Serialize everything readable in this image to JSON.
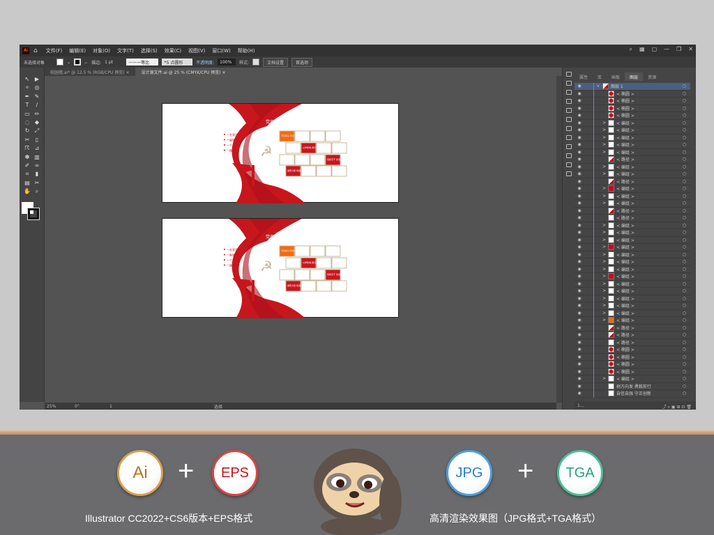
{
  "app": {
    "logo": "Ai",
    "home_icon": "home-icon"
  },
  "menu": [
    "文件(F)",
    "编辑(E)",
    "对象(O)",
    "文字(T)",
    "选择(S)",
    "效果(C)",
    "视图(V)",
    "窗口(W)",
    "帮助(H)"
  ],
  "control": {
    "selection": "未选择对象",
    "stroke_label": "描边:",
    "stroke_value": "1 pt",
    "profile": "等比",
    "brush": "5 点圆形",
    "opacity_label": "不透明度:",
    "opacity": "100%",
    "style_label": "样式:",
    "doc_setup": "文档设置",
    "prefs": "首选项"
  },
  "tabs": [
    {
      "label": "校园墙.ai* @ 12.5 % (RGB/CPU 预览)"
    },
    {
      "label": "设计源文件.ai @ 25 % (CMYK/CPU 预览)"
    }
  ],
  "status": {
    "zoom": "25%",
    "rotation": "0°",
    "page": "1",
    "tool": "选择"
  },
  "panel": {
    "tabs": [
      "属性",
      "库",
      "画板",
      "图层",
      "资源"
    ],
    "footer": "1..."
  },
  "layers": [
    {
      "name": "图层 1",
      "thumb": "top",
      "exp": "v"
    },
    {
      "name": "< 椭圆 >",
      "thumb": "dot"
    },
    {
      "name": "< 椭圆 >",
      "thumb": "dot"
    },
    {
      "name": "< 椭圆 >",
      "thumb": "dot"
    },
    {
      "name": "< 椭圆 >",
      "thumb": "dot"
    },
    {
      "name": "< 编组 >",
      "thumb": "white",
      "exp": ">"
    },
    {
      "name": "< 编组 >",
      "thumb": "white",
      "exp": ">"
    },
    {
      "name": "< 编组 >",
      "thumb": "white",
      "exp": ">"
    },
    {
      "name": "< 编组 >",
      "thumb": "white",
      "exp": ">"
    },
    {
      "name": "< 编组 >",
      "thumb": "white",
      "exp": ">"
    },
    {
      "name": "< 路径 >",
      "thumb": "path"
    },
    {
      "name": "< 编组 >",
      "thumb": "white",
      "exp": ">"
    },
    {
      "name": "< 编组 >",
      "thumb": "white",
      "exp": ">"
    },
    {
      "name": "< 路径 >",
      "thumb": "path"
    },
    {
      "name": "< 编组 >",
      "thumb": "red",
      "exp": ">"
    },
    {
      "name": "< 编组 >",
      "thumb": "white",
      "exp": ">"
    },
    {
      "name": "< 编组 >",
      "thumb": "white",
      "exp": ">"
    },
    {
      "name": "< 路径 >",
      "thumb": "path"
    },
    {
      "name": "< 路径 >",
      "thumb": "white"
    },
    {
      "name": "< 编组 >",
      "thumb": "white",
      "exp": ">"
    },
    {
      "name": "< 编组 >",
      "thumb": "white",
      "exp": ">"
    },
    {
      "name": "< 编组 >",
      "thumb": "white",
      "exp": ">"
    },
    {
      "name": "< 编组 >",
      "thumb": "red",
      "exp": ">"
    },
    {
      "name": "< 编组 >",
      "thumb": "white",
      "exp": ">"
    },
    {
      "name": "< 编组 >",
      "thumb": "white",
      "exp": ">"
    },
    {
      "name": "< 编组 >",
      "thumb": "white",
      "exp": ">"
    },
    {
      "name": "< 编组 >",
      "thumb": "red",
      "exp": ">"
    },
    {
      "name": "< 编组 >",
      "thumb": "white",
      "exp": ">"
    },
    {
      "name": "< 编组 >",
      "thumb": "white",
      "exp": ">"
    },
    {
      "name": "< 编组 >",
      "thumb": "white",
      "exp": ">"
    },
    {
      "name": "< 编组 >",
      "thumb": "white",
      "exp": ">"
    },
    {
      "name": "< 编组 >",
      "thumb": "white",
      "exp": ">"
    },
    {
      "name": "< 编组 >",
      "thumb": "orange",
      "exp": ">"
    },
    {
      "name": "< 路径 >",
      "thumb": "path"
    },
    {
      "name": "< 路径 >",
      "thumb": "path"
    },
    {
      "name": "< 路径 >",
      "thumb": "white"
    },
    {
      "name": "< 椭圆 >",
      "thumb": "dot"
    },
    {
      "name": "< 椭圆 >",
      "thumb": "dot"
    },
    {
      "name": "< 椭圆 >",
      "thumb": "dot"
    },
    {
      "name": "< 椭圆 >",
      "thumb": "dot"
    },
    {
      "name": "< 编组 >",
      "thumb": "white",
      "exp": ">"
    },
    {
      "name": "树方向发 勇毅前行",
      "thumb": "white"
    },
    {
      "name": "自信自强 守正创新",
      "thumb": "white"
    }
  ],
  "artwork": {
    "title_small": "党员",
    "title_big": "风采",
    "bullets": [
      "一名党员",
      "一面旗帜",
      "一个支部",
      "一座堡垒"
    ],
    "red_boxes": [
      "不忘初心 牢记使命",
      "以学铸魂 践行宗旨",
      "真抓实干 担当作为",
      "凝聚力量 铸就辉煌"
    ],
    "colors": {
      "red": "#c8161d",
      "orange": "#f26b10",
      "gold": "#c8b89a"
    }
  },
  "banner": {
    "badges": [
      {
        "label": "Ai",
        "color": "#b8731f",
        "ring": "#d9a050"
      },
      {
        "label": "EPS",
        "color": "#c8161d",
        "ring": "#d44"
      },
      {
        "label": "JPG",
        "color": "#2a7ec8",
        "ring": "#4aa0e0"
      },
      {
        "label": "TGA",
        "color": "#2aa07a",
        "ring": "#4cc09a"
      }
    ],
    "plus": "+",
    "left_caption": "Illustrator CC2022+CS6版本+EPS格式",
    "right_caption": "高清渲染效果图（JPG格式+TGA格式）"
  }
}
